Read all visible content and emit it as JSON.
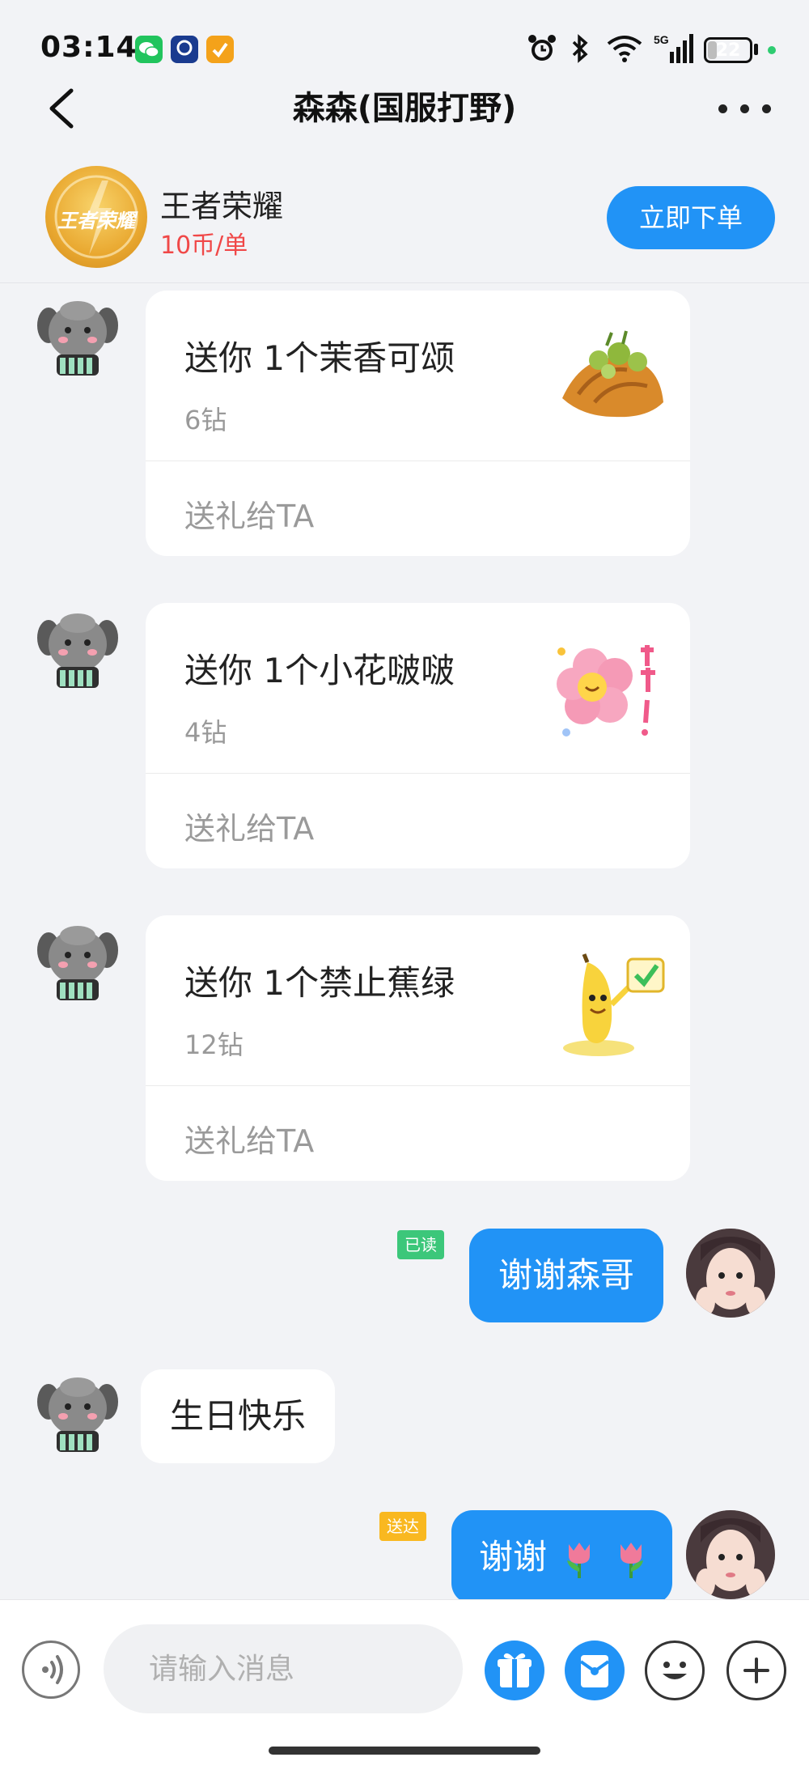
{
  "status_bar": {
    "time": "03:14",
    "battery": "22",
    "battery_level": 0.22,
    "signal_label": "5G"
  },
  "header": {
    "title": "森森(国服打野)"
  },
  "game": {
    "logo_text": "王者荣耀",
    "name": "王者荣耀",
    "price": "10币/单",
    "order_label": "立即下单"
  },
  "gifts": [
    {
      "title": "送你 1个茉香可颂",
      "price": "6钻",
      "action": "送礼给TA"
    },
    {
      "title": "送你 1个小花啵啵",
      "price": "4钻",
      "action": "送礼给TA"
    },
    {
      "title": "送你 1个禁止蕉绿",
      "price": "12钻",
      "action": "送礼给TA"
    }
  ],
  "messages": [
    {
      "text": "谢谢森哥",
      "status": "已读"
    },
    {
      "text": "生日快乐"
    },
    {
      "text": "谢谢",
      "status": "送达"
    }
  ],
  "input": {
    "placeholder": "请输入消息"
  },
  "colors": {
    "accent": "#2193f6",
    "price_red": "#f04848",
    "read_green": "#3cc77a",
    "delivered_yellow": "#f9b820"
  }
}
